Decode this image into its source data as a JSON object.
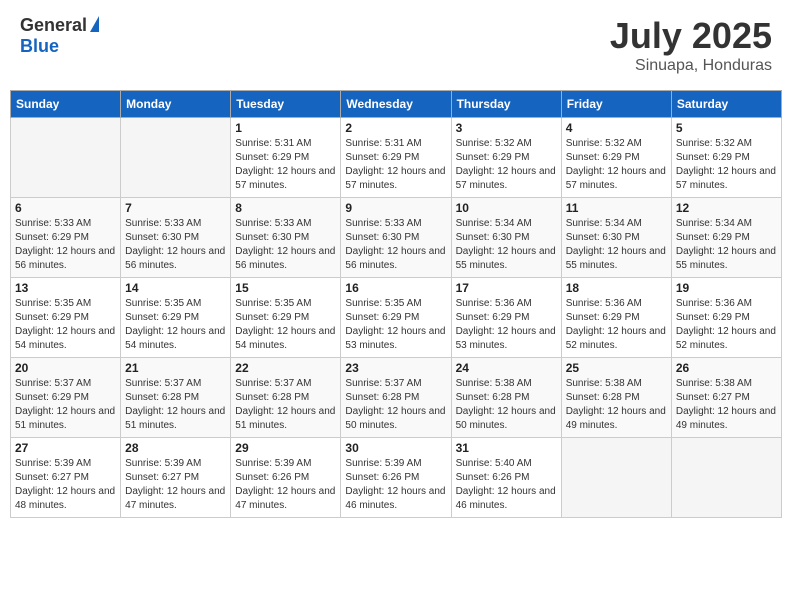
{
  "logo": {
    "general": "General",
    "blue": "Blue"
  },
  "title": "July 2025",
  "location": "Sinuapa, Honduras",
  "weekdays": [
    "Sunday",
    "Monday",
    "Tuesday",
    "Wednesday",
    "Thursday",
    "Friday",
    "Saturday"
  ],
  "days": [
    {
      "date": "",
      "sunrise": "",
      "sunset": "",
      "daylight": ""
    },
    {
      "date": "",
      "sunrise": "",
      "sunset": "",
      "daylight": ""
    },
    {
      "date": "1",
      "sunrise": "Sunrise: 5:31 AM",
      "sunset": "Sunset: 6:29 PM",
      "daylight": "Daylight: 12 hours and 57 minutes."
    },
    {
      "date": "2",
      "sunrise": "Sunrise: 5:31 AM",
      "sunset": "Sunset: 6:29 PM",
      "daylight": "Daylight: 12 hours and 57 minutes."
    },
    {
      "date": "3",
      "sunrise": "Sunrise: 5:32 AM",
      "sunset": "Sunset: 6:29 PM",
      "daylight": "Daylight: 12 hours and 57 minutes."
    },
    {
      "date": "4",
      "sunrise": "Sunrise: 5:32 AM",
      "sunset": "Sunset: 6:29 PM",
      "daylight": "Daylight: 12 hours and 57 minutes."
    },
    {
      "date": "5",
      "sunrise": "Sunrise: 5:32 AM",
      "sunset": "Sunset: 6:29 PM",
      "daylight": "Daylight: 12 hours and 57 minutes."
    },
    {
      "date": "6",
      "sunrise": "Sunrise: 5:33 AM",
      "sunset": "Sunset: 6:29 PM",
      "daylight": "Daylight: 12 hours and 56 minutes."
    },
    {
      "date": "7",
      "sunrise": "Sunrise: 5:33 AM",
      "sunset": "Sunset: 6:30 PM",
      "daylight": "Daylight: 12 hours and 56 minutes."
    },
    {
      "date": "8",
      "sunrise": "Sunrise: 5:33 AM",
      "sunset": "Sunset: 6:30 PM",
      "daylight": "Daylight: 12 hours and 56 minutes."
    },
    {
      "date": "9",
      "sunrise": "Sunrise: 5:33 AM",
      "sunset": "Sunset: 6:30 PM",
      "daylight": "Daylight: 12 hours and 56 minutes."
    },
    {
      "date": "10",
      "sunrise": "Sunrise: 5:34 AM",
      "sunset": "Sunset: 6:30 PM",
      "daylight": "Daylight: 12 hours and 55 minutes."
    },
    {
      "date": "11",
      "sunrise": "Sunrise: 5:34 AM",
      "sunset": "Sunset: 6:30 PM",
      "daylight": "Daylight: 12 hours and 55 minutes."
    },
    {
      "date": "12",
      "sunrise": "Sunrise: 5:34 AM",
      "sunset": "Sunset: 6:29 PM",
      "daylight": "Daylight: 12 hours and 55 minutes."
    },
    {
      "date": "13",
      "sunrise": "Sunrise: 5:35 AM",
      "sunset": "Sunset: 6:29 PM",
      "daylight": "Daylight: 12 hours and 54 minutes."
    },
    {
      "date": "14",
      "sunrise": "Sunrise: 5:35 AM",
      "sunset": "Sunset: 6:29 PM",
      "daylight": "Daylight: 12 hours and 54 minutes."
    },
    {
      "date": "15",
      "sunrise": "Sunrise: 5:35 AM",
      "sunset": "Sunset: 6:29 PM",
      "daylight": "Daylight: 12 hours and 54 minutes."
    },
    {
      "date": "16",
      "sunrise": "Sunrise: 5:35 AM",
      "sunset": "Sunset: 6:29 PM",
      "daylight": "Daylight: 12 hours and 53 minutes."
    },
    {
      "date": "17",
      "sunrise": "Sunrise: 5:36 AM",
      "sunset": "Sunset: 6:29 PM",
      "daylight": "Daylight: 12 hours and 53 minutes."
    },
    {
      "date": "18",
      "sunrise": "Sunrise: 5:36 AM",
      "sunset": "Sunset: 6:29 PM",
      "daylight": "Daylight: 12 hours and 52 minutes."
    },
    {
      "date": "19",
      "sunrise": "Sunrise: 5:36 AM",
      "sunset": "Sunset: 6:29 PM",
      "daylight": "Daylight: 12 hours and 52 minutes."
    },
    {
      "date": "20",
      "sunrise": "Sunrise: 5:37 AM",
      "sunset": "Sunset: 6:29 PM",
      "daylight": "Daylight: 12 hours and 51 minutes."
    },
    {
      "date": "21",
      "sunrise": "Sunrise: 5:37 AM",
      "sunset": "Sunset: 6:28 PM",
      "daylight": "Daylight: 12 hours and 51 minutes."
    },
    {
      "date": "22",
      "sunrise": "Sunrise: 5:37 AM",
      "sunset": "Sunset: 6:28 PM",
      "daylight": "Daylight: 12 hours and 51 minutes."
    },
    {
      "date": "23",
      "sunrise": "Sunrise: 5:37 AM",
      "sunset": "Sunset: 6:28 PM",
      "daylight": "Daylight: 12 hours and 50 minutes."
    },
    {
      "date": "24",
      "sunrise": "Sunrise: 5:38 AM",
      "sunset": "Sunset: 6:28 PM",
      "daylight": "Daylight: 12 hours and 50 minutes."
    },
    {
      "date": "25",
      "sunrise": "Sunrise: 5:38 AM",
      "sunset": "Sunset: 6:28 PM",
      "daylight": "Daylight: 12 hours and 49 minutes."
    },
    {
      "date": "26",
      "sunrise": "Sunrise: 5:38 AM",
      "sunset": "Sunset: 6:27 PM",
      "daylight": "Daylight: 12 hours and 49 minutes."
    },
    {
      "date": "27",
      "sunrise": "Sunrise: 5:39 AM",
      "sunset": "Sunset: 6:27 PM",
      "daylight": "Daylight: 12 hours and 48 minutes."
    },
    {
      "date": "28",
      "sunrise": "Sunrise: 5:39 AM",
      "sunset": "Sunset: 6:27 PM",
      "daylight": "Daylight: 12 hours and 47 minutes."
    },
    {
      "date": "29",
      "sunrise": "Sunrise: 5:39 AM",
      "sunset": "Sunset: 6:26 PM",
      "daylight": "Daylight: 12 hours and 47 minutes."
    },
    {
      "date": "30",
      "sunrise": "Sunrise: 5:39 AM",
      "sunset": "Sunset: 6:26 PM",
      "daylight": "Daylight: 12 hours and 46 minutes."
    },
    {
      "date": "31",
      "sunrise": "Sunrise: 5:40 AM",
      "sunset": "Sunset: 6:26 PM",
      "daylight": "Daylight: 12 hours and 46 minutes."
    },
    {
      "date": "",
      "sunrise": "",
      "sunset": "",
      "daylight": ""
    },
    {
      "date": "",
      "sunrise": "",
      "sunset": "",
      "daylight": ""
    }
  ]
}
